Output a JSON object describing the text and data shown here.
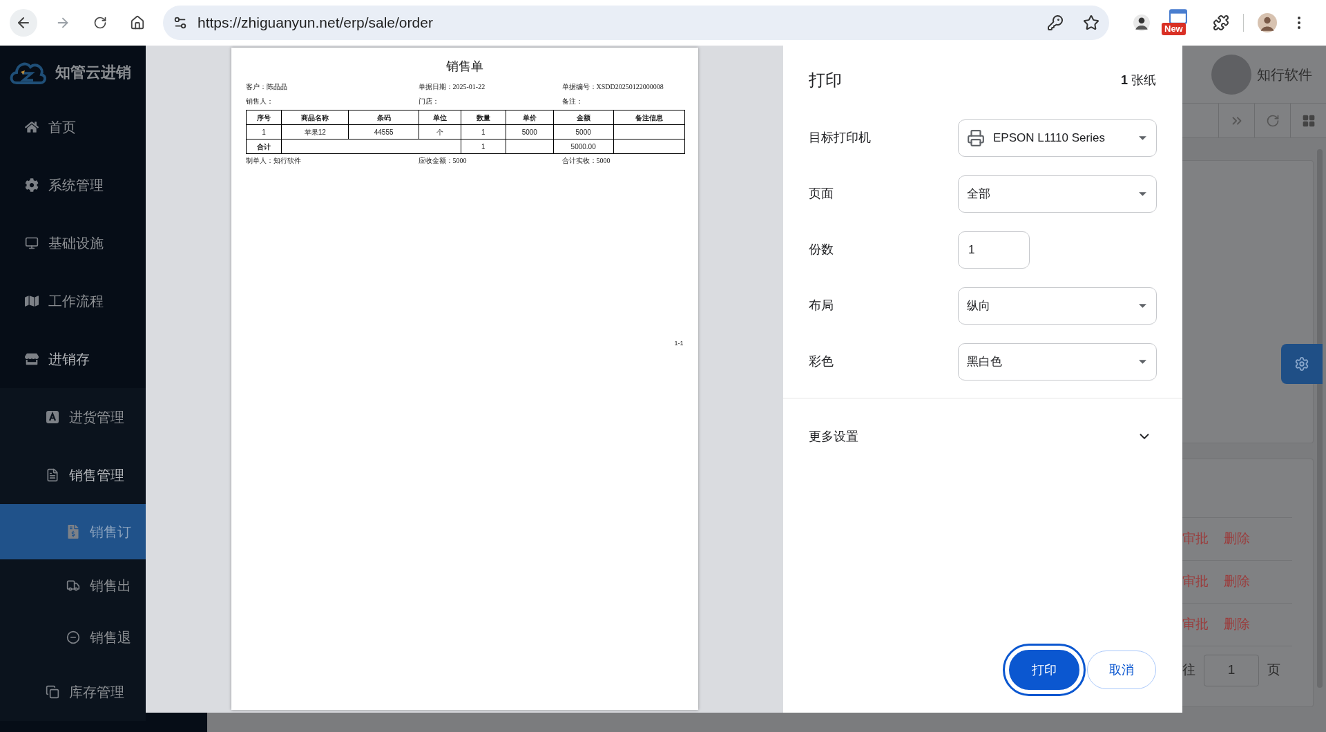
{
  "browser": {
    "url": "https://zhiguanyun.net/erp/sale/order",
    "extension_badge": "New"
  },
  "sidebar": {
    "brand": "知管云进销",
    "items": [
      {
        "label": "首页",
        "selected": false
      },
      {
        "label": "系统管理",
        "selected": false
      },
      {
        "label": "基础设施",
        "selected": false
      },
      {
        "label": "工作流程",
        "selected": false
      },
      {
        "label": "进销存",
        "selected": false,
        "expanded": true,
        "children": [
          {
            "label": "进货管理",
            "selected": false
          },
          {
            "label": "销售管理",
            "selected": false,
            "expanded": true,
            "children": [
              {
                "label": "销售订",
                "selected": true
              },
              {
                "label": "销售出",
                "selected": false
              },
              {
                "label": "销售退",
                "selected": false
              }
            ]
          },
          {
            "label": "库存管理",
            "selected": false
          }
        ]
      }
    ]
  },
  "print_preview": {
    "document": {
      "title": "销售单",
      "info": [
        "客户：陈晶晶",
        "单据日期：2025-01-22",
        "单据编号：XSDD20250122000008",
        "销售人：",
        "门店：",
        "备注："
      ],
      "table": {
        "columns": [
          "序号",
          "商品名称",
          "条码",
          "单位",
          "数量",
          "单价",
          "金额",
          "备注信息"
        ],
        "rows": [
          [
            "1",
            "苹果12",
            "44555",
            "个",
            "1",
            "5000",
            "5000",
            ""
          ]
        ],
        "total": {
          "label": "合计",
          "quantity": "1",
          "amount": "5000.00"
        }
      },
      "footer": [
        "制单人：知行软件",
        "应收金额：5000",
        "合计实收：5000"
      ],
      "page_number": "1-1"
    }
  },
  "print_settings": {
    "title": "打印",
    "sheets": "**1** 张纸",
    "fields": [
      {
        "label": "目标打印机",
        "kind": "select",
        "value": "EPSON L1110 Series"
      },
      {
        "label": "页面",
        "kind": "select",
        "value": "全部"
      },
      {
        "label": "份数",
        "kind": "number",
        "value": "1"
      },
      {
        "label": "布局",
        "kind": "select",
        "value": "纵向"
      },
      {
        "label": "彩色",
        "kind": "select",
        "value": "黑白色"
      }
    ],
    "more_settings": {
      "label": "更多设置",
      "expanded": false
    },
    "buttons": [
      {
        "label": "打印",
        "kind": "primary"
      },
      {
        "label": "取消",
        "kind": "secondary"
      }
    ]
  },
  "background_page": {
    "user_name": "知行软件",
    "rows": [
      [
        "审批",
        "删除"
      ],
      [
        "审批",
        "删除"
      ],
      [
        "审批",
        "删除"
      ]
    ],
    "pagination": {
      "before": "往",
      "page": "1",
      "after": "页"
    }
  }
}
